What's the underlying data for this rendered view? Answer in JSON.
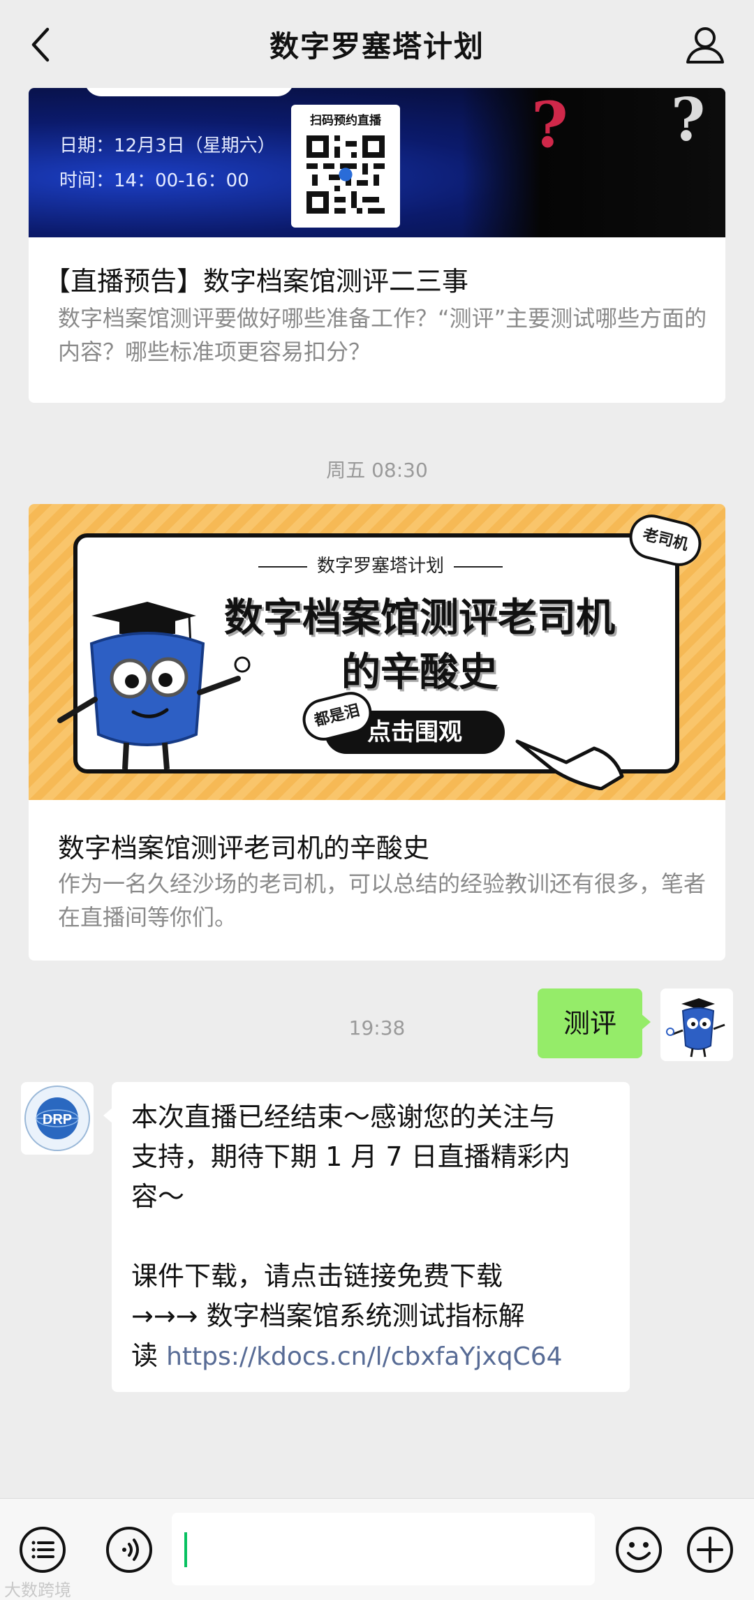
{
  "header": {
    "title": "数字罗塞塔计划",
    "icons": {
      "back": "chevron-left-icon",
      "profile": "person-icon"
    }
  },
  "article1": {
    "date_line": "日期：12月3日（星期六）",
    "time_line": "时间：14：00-16：00",
    "qr_label": "扫码预约直播",
    "title": "【直播预告】数字档案馆测评二三事",
    "description": "数字档案馆测评要做好哪些准备工作？“测评”主要测试哪些方面的内容？哪些标准项更容易扣分？"
  },
  "timestamp1": "周五 08:30",
  "article2": {
    "cover_brand": "数字罗塞塔计划",
    "cover_headline_1": "数字档案馆测评老司机",
    "cover_headline_2": "的辛酸史",
    "cover_button": "点击围观",
    "cover_bubble_cry": "都是泪",
    "cover_bubble_old": "老司机",
    "title": "数字档案馆测评老司机的辛酸史",
    "description": "作为一名久经沙场的老司机，可以总结的经验教训还有很多，笔者在直播间等你们。"
  },
  "timestamp2": "19:38",
  "chat": {
    "outgoing": "测评",
    "incoming_lines": [
      "本次直播已经结束～感谢您的关注与",
      "支持，期待下期 1 月 7 日直播精彩内",
      "容～",
      "",
      "课件下载，请点击链接免费下载",
      "→→→ 数字档案馆系统测试指标解"
    ],
    "incoming_last_prefix": "读 ",
    "incoming_link": "https://kdocs.cn/l/cbxfaYjxqC64",
    "bot_avatar_text": "DRP"
  },
  "input": {
    "value": "",
    "icons": [
      "menu-list-icon",
      "voice-icon",
      "emoji-icon",
      "plus-icon"
    ]
  },
  "watermark": "大数跨境",
  "colors": {
    "background": "#ededed",
    "bubble_out": "#95ec69",
    "link": "#576b95",
    "caret": "#07c160"
  }
}
